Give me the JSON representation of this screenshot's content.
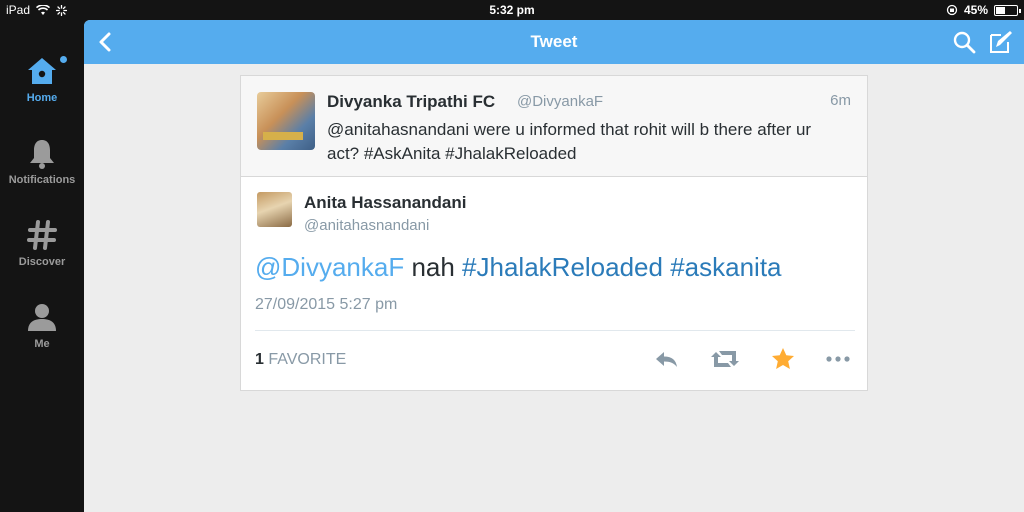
{
  "status_bar": {
    "device": "iPad",
    "time": "5:32 pm",
    "battery": "45%",
    "battery_level": 0.45
  },
  "sidebar": {
    "items": [
      {
        "label": "Home",
        "icon": "home-icon",
        "active": true
      },
      {
        "label": "Notifications",
        "icon": "bell-icon",
        "active": false
      },
      {
        "label": "Discover",
        "icon": "hashtag-icon",
        "active": false
      },
      {
        "label": "Me",
        "icon": "person-icon",
        "active": false
      }
    ]
  },
  "header": {
    "title": "Tweet"
  },
  "parent_tweet": {
    "name": "Divyanka Tripathi FC",
    "handle": "@DivyankaF",
    "time": "6m",
    "text": "@anitahasnandani were u informed that rohit will b there after ur act? #AskAnita #JhalakReloaded"
  },
  "tweet": {
    "name": "Anita Hassanandani",
    "handle": "@anitahasnandani",
    "text_parts": {
      "mention": "@DivyankaF",
      "plain": " nah ",
      "hashtag1": "#JhalakReloaded",
      "hashtag2": "#askanita"
    },
    "timestamp": "27/09/2015 5:27 pm",
    "favorite_count": "1",
    "favorite_label": "FAVORITE"
  },
  "colors": {
    "accent": "#55acee",
    "favorite": "#ffac33",
    "sidebar_bg": "#141414"
  }
}
